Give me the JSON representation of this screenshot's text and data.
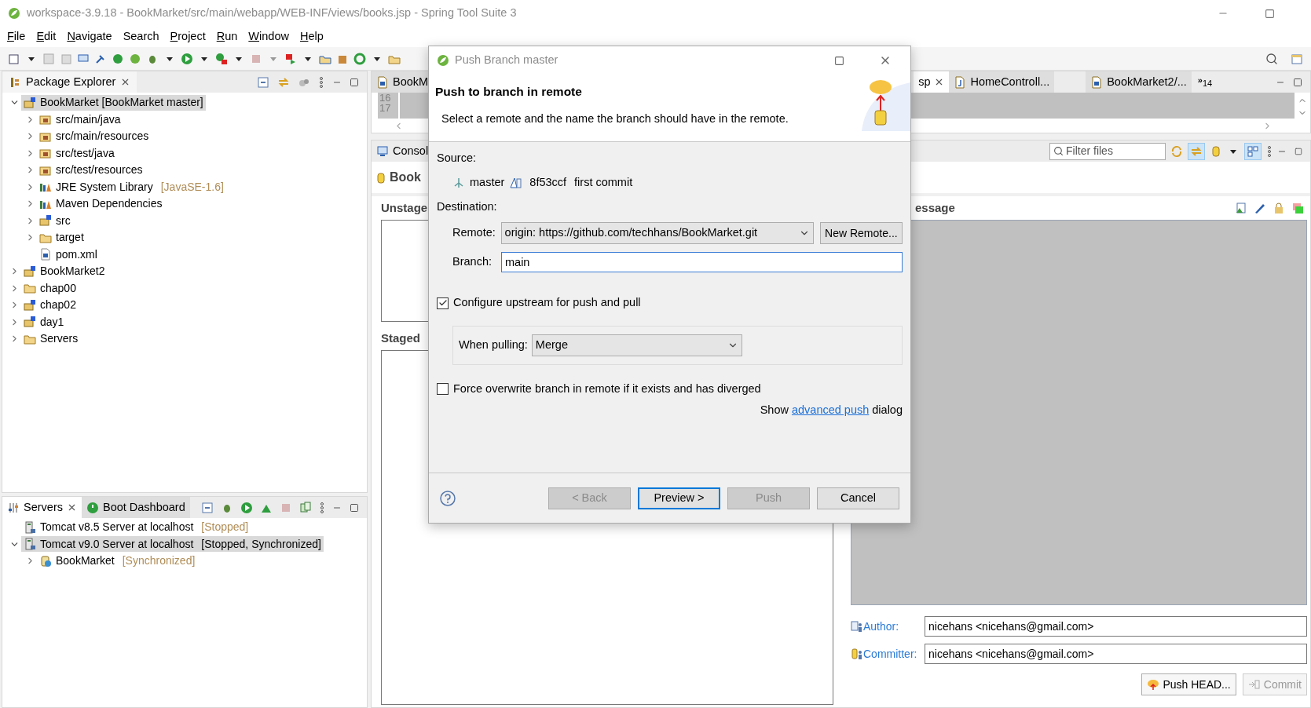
{
  "window": {
    "title": "workspace-3.9.18 - BookMarket/src/main/webapp/WEB-INF/views/books.jsp - Spring Tool Suite 3"
  },
  "menu": [
    {
      "label": "File",
      "underlined": true
    },
    {
      "label": "Edit",
      "underlined": true
    },
    {
      "label": "Navigate",
      "underlined": true
    },
    {
      "label": "Search",
      "underlined": false
    },
    {
      "label": "Project",
      "underlined": true
    },
    {
      "label": "Run",
      "underlined": true
    },
    {
      "label": "Window",
      "underlined": true
    },
    {
      "label": "Help",
      "underlined": true
    }
  ],
  "package_explorer": {
    "title": "Package Explorer",
    "items": [
      {
        "label": "BookMarket [BookMarket master]",
        "kind": "project",
        "expanded": true,
        "selected": true,
        "children": [
          {
            "label": "src/main/java",
            "kind": "source",
            "expanded": false,
            "selected": false
          },
          {
            "label": "src/main/resources",
            "kind": "source",
            "expanded": false,
            "selected": false
          },
          {
            "label": "src/test/java",
            "kind": "source",
            "expanded": false,
            "selected": false
          },
          {
            "label": "src/test/resources",
            "kind": "source",
            "expanded": false,
            "selected": false
          },
          {
            "label": "JRE System Library",
            "decoration": "[JavaSE-1.6]",
            "kind": "library",
            "expanded": false,
            "selected": false
          },
          {
            "label": "Maven Dependencies",
            "kind": "library",
            "expanded": false,
            "selected": false
          },
          {
            "label": "src",
            "kind": "project",
            "expanded": false,
            "selected": false
          },
          {
            "label": "target",
            "kind": "folder",
            "expanded": false,
            "selected": false
          },
          {
            "label": "pom.xml",
            "kind": "file",
            "selected": false
          }
        ]
      },
      {
        "label": "BookMarket2",
        "kind": "project",
        "expanded": false,
        "selected": false
      },
      {
        "label": "chap00",
        "kind": "folder",
        "expanded": false,
        "selected": false
      },
      {
        "label": "chap02",
        "kind": "project",
        "expanded": false,
        "selected": false
      },
      {
        "label": "day1",
        "kind": "project",
        "expanded": false,
        "selected": false
      },
      {
        "label": "Servers",
        "kind": "folder",
        "expanded": false,
        "selected": false
      }
    ]
  },
  "servers": {
    "tabs": [
      {
        "label": "Servers",
        "selected": true
      },
      {
        "label": "Boot Dashboard",
        "selected": false
      }
    ],
    "items": [
      {
        "label": "Tomcat v8.5 Server at localhost",
        "decoration": "[Stopped]",
        "kind": "server",
        "selected": false
      },
      {
        "label": "Tomcat v9.0 Server at localhost",
        "decoration": "[Stopped, Synchronized]",
        "kind": "server",
        "expanded": true,
        "selected": true,
        "children": [
          {
            "label": "BookMarket",
            "decoration": "[Synchronized]",
            "kind": "module",
            "expanded": false,
            "selected": false
          }
        ]
      }
    ]
  },
  "editor": {
    "tabs": [
      {
        "label": "BookM",
        "selected": false,
        "closable": false
      },
      {
        "label": "sp",
        "selected": true,
        "closable": true
      },
      {
        "label": "HomeControll...",
        "selected": false,
        "closable": false
      },
      {
        "label": "BookMarket2/...",
        "selected": false,
        "closable": false
      }
    ],
    "overflow_mark": "»",
    "overflow_count": "14",
    "line_numbers": [
      "16",
      "17"
    ]
  },
  "staging": {
    "tab": "Consol",
    "title": "Book",
    "unstaged": "Unstage",
    "staged": "Staged",
    "commit_header": "essage",
    "filter_placeholder": "Filter files",
    "author_label": "Author:",
    "author": "nicehans <nicehans@gmail.com>",
    "committer_label": "Committer:",
    "committer": "nicehans <nicehans@gmail.com>",
    "buttons": [
      {
        "label": "Push HEAD...",
        "disabled": false
      },
      {
        "label": "Commit",
        "disabled": true
      }
    ]
  },
  "dialog": {
    "title": "Push Branch master",
    "heading": "Push to branch in remote",
    "description": "Select a remote and the name the branch should have in the remote.",
    "source_label": "Source:",
    "source_branch": "master",
    "source_commit_id": "8f53ccf",
    "source_commit_message": "first commit",
    "destination_label": "Destination:",
    "remote_label": "Remote:",
    "remote_value": "origin: https://github.com/techhans/BookMarket.git",
    "new_remote_button": "New Remote...",
    "branch_label": "Branch:",
    "branch_value": "main",
    "configure": {
      "label": "Configure upstream for push and pull",
      "checked": true
    },
    "when_pulling_label": "When pulling:",
    "when_pulling_value": "Merge",
    "force": {
      "label": "Force overwrite branch in remote if it exists and has diverged",
      "checked": false
    },
    "advanced": {
      "before": "Show",
      "link": "advanced push",
      "after": "dialog"
    },
    "buttons": [
      {
        "label": "< Back",
        "disabled": true,
        "default": false
      },
      {
        "label": "Preview >",
        "disabled": false,
        "default": true
      },
      {
        "label": "Push",
        "disabled": true,
        "default": false
      },
      {
        "label": "Cancel",
        "disabled": false,
        "default": false
      }
    ]
  }
}
